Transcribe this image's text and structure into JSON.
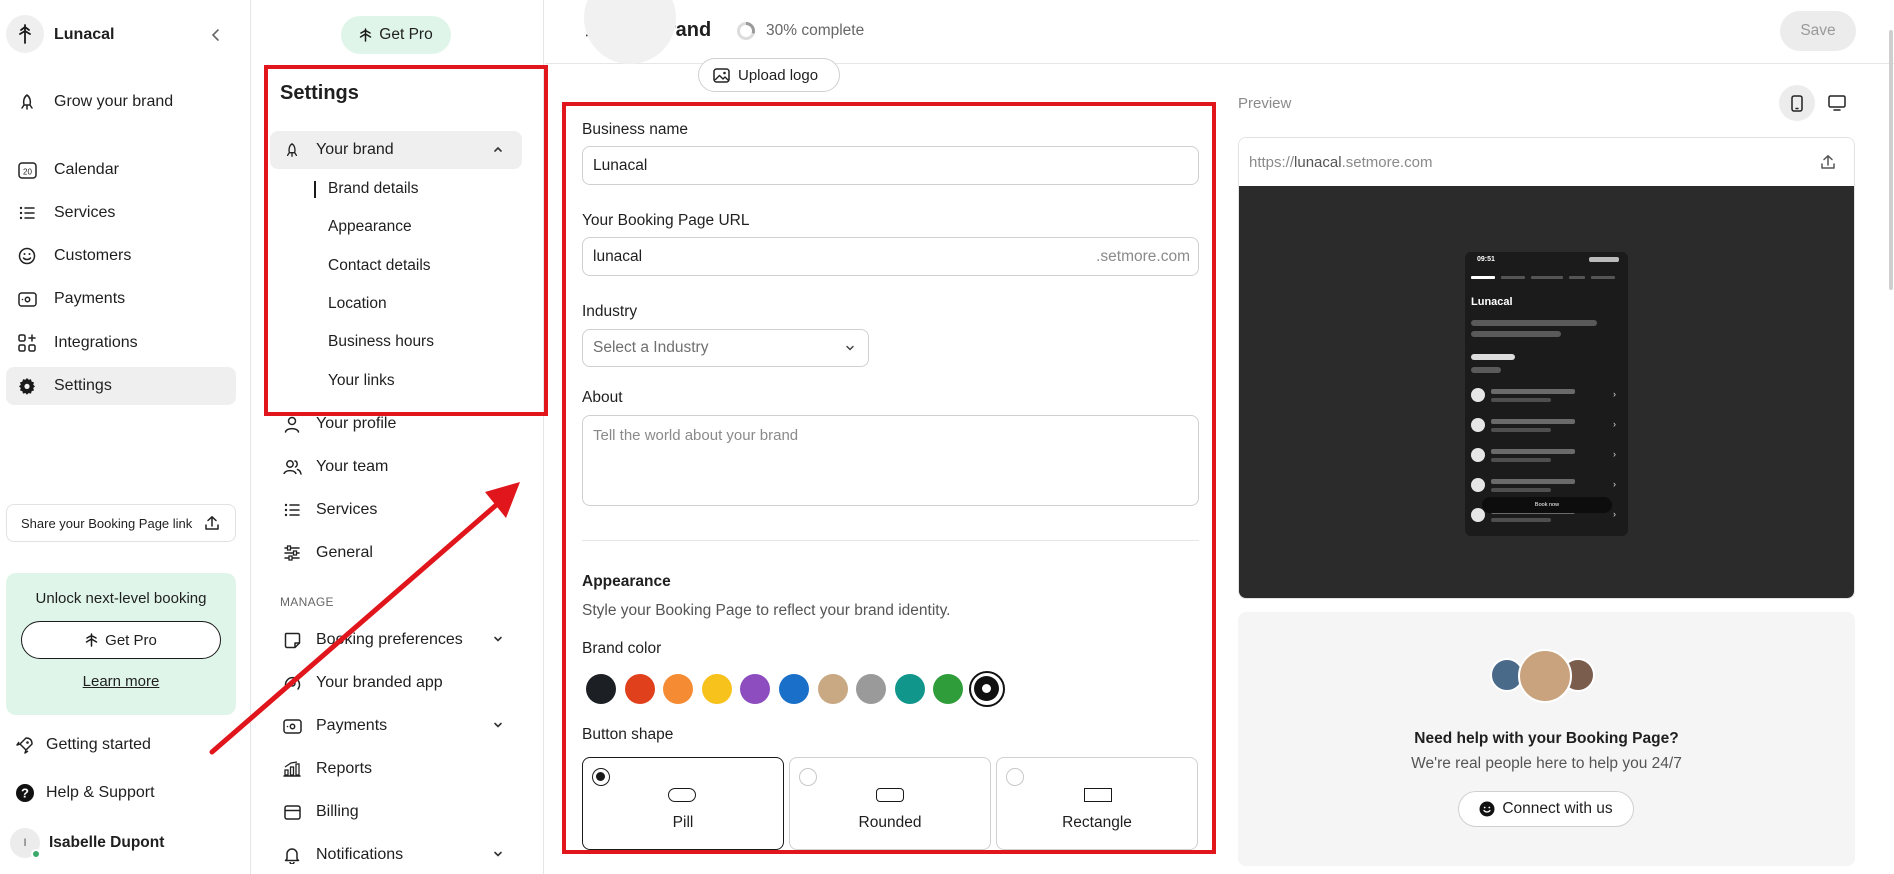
{
  "sidebar": {
    "brand_name": "Lunacal",
    "items": [
      {
        "label": "Grow your brand",
        "icon": "rocket-icon"
      },
      {
        "label": "Calendar",
        "icon": "calendar-icon"
      },
      {
        "label": "Services",
        "icon": "list-icon"
      },
      {
        "label": "Customers",
        "icon": "smile-icon"
      },
      {
        "label": "Payments",
        "icon": "payments-icon"
      },
      {
        "label": "Integrations",
        "icon": "integrations-icon"
      },
      {
        "label": "Settings",
        "icon": "gear-icon"
      }
    ],
    "share_label": "Share your Booking Page link",
    "promo_title": "Unlock next-level booking",
    "promo_button": "Get Pro",
    "promo_link": "Learn more",
    "getting_started": "Getting started",
    "help": "Help & Support",
    "user_initial": "I",
    "user_name": "Isabelle Dupont"
  },
  "settings_panel": {
    "get_pro": "Get Pro",
    "title": "Settings",
    "your_brand": "Your brand",
    "brand_sub": [
      "Brand details",
      "Appearance",
      "Contact details",
      "Location",
      "Business hours",
      "Your links"
    ],
    "items": [
      "Your profile",
      "Your team",
      "Services",
      "General"
    ],
    "manage_header": "MANAGE",
    "manage_items": [
      "Booking preferences",
      "Your branded app",
      "Payments",
      "Reports",
      "Billing",
      "Notifications"
    ]
  },
  "header": {
    "title": "Your brand",
    "progress_text": "30% complete",
    "progress_fraction": 0.3,
    "save_label": "Save"
  },
  "form": {
    "upload_logo": "Upload logo",
    "business_name_label": "Business name",
    "business_name_value": "Lunacal",
    "url_label": "Your Booking Page URL",
    "url_value": "lunacal",
    "url_suffix": ".setmore.com",
    "industry_label": "Industry",
    "industry_placeholder": "Select a Industry",
    "about_label": "About",
    "about_placeholder": "Tell the world about your brand",
    "appearance_title": "Appearance",
    "appearance_desc": "Style your Booking Page to reflect your brand identity.",
    "brand_color_label": "Brand color",
    "brand_colors": [
      "#1c1f24",
      "#e1401c",
      "#f58c33",
      "#f7c21b",
      "#8e4dbf",
      "#1a6fc9",
      "#c9a983",
      "#9a9a9a",
      "#11968c",
      "#2f9e3a",
      "#111111"
    ],
    "button_shape_label": "Button shape",
    "shapes": [
      "Pill",
      "Rounded",
      "Rectangle"
    ]
  },
  "preview": {
    "label": "Preview",
    "url_prefix": "https://",
    "url_main": "lunacal",
    "url_suffix": ".setmore.com",
    "phone_time": "09:51",
    "phone_title": "Lunacal",
    "phone_button": "Book now",
    "help_title": "Need help with your Booking Page?",
    "help_sub": "We're real people here to help you 24/7",
    "connect": "Connect with us"
  },
  "colors": {
    "accent_green_bg": "#dff5ea",
    "annotation_red": "#e0161c",
    "preview_dark": "#2b2b2b"
  }
}
